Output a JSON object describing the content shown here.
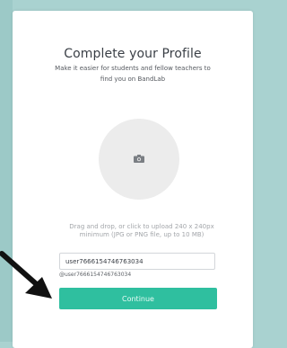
{
  "profile": {
    "title": "Complete your Profile",
    "subtitle": "Make it easier for students and fellow teachers to find you on BandLab"
  },
  "upload": {
    "icon": "camera-icon",
    "hint": "Drag and drop, or click to upload 240 x 240px minimum (JPG or PNG file, up to 10 MB)"
  },
  "username": {
    "value": "user7666154746763034",
    "handle": "@user7666154746763034"
  },
  "actions": {
    "continue_label": "Continue"
  },
  "colors": {
    "accent": "#2fbf9f",
    "background": "#a9d2d0",
    "arrow": "#111111"
  }
}
